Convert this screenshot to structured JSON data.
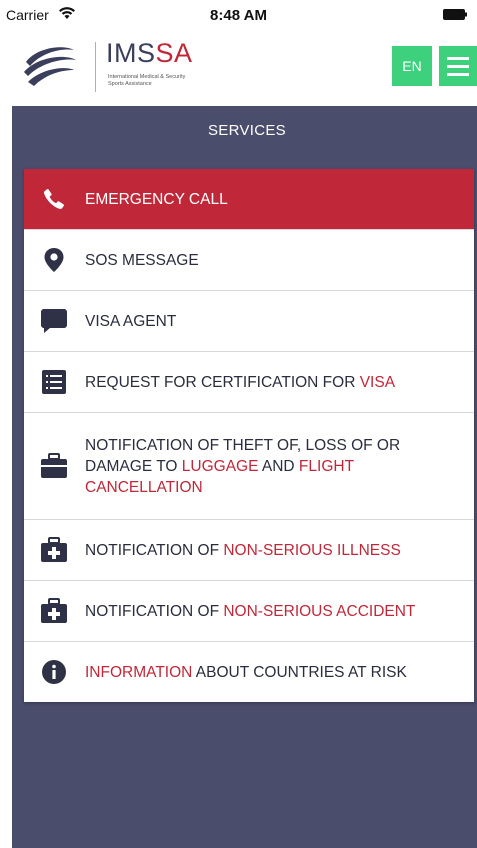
{
  "status_bar": {
    "carrier": "Carrier",
    "time": "8:48 AM"
  },
  "header": {
    "brand_part1": "IMS",
    "brand_part2": "SA",
    "tagline_line1": "International Medical & Security",
    "tagline_line2": "Sports Assistance",
    "language_button": "EN"
  },
  "colors": {
    "accent_red": "#c0283a",
    "panel_bg": "#4a4d6b",
    "green_button": "#3ed17d"
  },
  "services": {
    "title": "SERVICES",
    "items": [
      {
        "icon": "phone-icon",
        "parts": [
          "EMERGENCY CALL"
        ],
        "active": true
      },
      {
        "icon": "map-pin-icon",
        "parts": [
          "SOS MESSAGE"
        ]
      },
      {
        "icon": "chat-bubble-icon",
        "parts": [
          "VISA AGENT"
        ]
      },
      {
        "icon": "list-document-icon",
        "parts": [
          "REQUEST FOR CERTIFICATION FOR ",
          "VISA"
        ]
      },
      {
        "icon": "suitcase-icon",
        "parts": [
          "NOTIFICATION OF THEFT OF, LOSS OF OR DAMAGE TO ",
          "LUGGAGE",
          " AND ",
          "FLIGHT CANCELLATION"
        ]
      },
      {
        "icon": "medical-kit-icon",
        "parts": [
          "NOTIFICATION OF ",
          "NON-SERIOUS ILLNESS"
        ]
      },
      {
        "icon": "medical-kit-icon",
        "parts": [
          "NOTIFICATION OF ",
          "NON-SERIOUS ACCIDENT"
        ]
      },
      {
        "icon": "info-icon",
        "parts": [
          "INFORMATION",
          " ABOUT COUNTRIES AT RISK"
        ]
      }
    ]
  }
}
